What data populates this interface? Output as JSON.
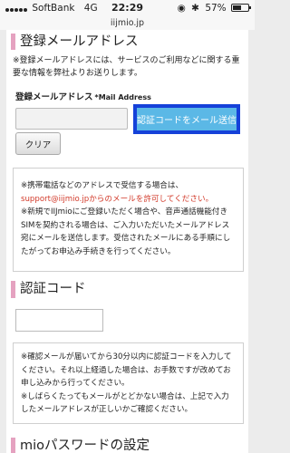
{
  "status": {
    "carrier": "SoftBank",
    "network": "4G",
    "time": "22:29",
    "battery": "57%",
    "battery_level": 0.57
  },
  "url": "iijmio.jp",
  "email_section": {
    "title": "登録メールアドレス",
    "description": "※登録メールアドレスには、サービスのご利用などに関する重要な情報を弊社よりお送りします。",
    "label": "登録メールアドレス",
    "label_sub": "*Mail Address",
    "email_value": "",
    "send_button": "認証コードをメール送信",
    "clear_button": "クリア",
    "notice": {
      "line1": "※携帯電話などのアドレスで受信する場合は、",
      "line2_red": "support@iijmio.jpからのメールを許可してください。",
      "line3": "※新規でIIJmioにご登録いただく場合や、音声通話機能付きSIMを契約される場合は、ご入力いただいたメールアドレス宛にメールを送信します。受信されたメールにある手順にしたがってお申込み手続きを行ってください。"
    }
  },
  "code_section": {
    "title": "認証コード",
    "code_value": "",
    "notice": {
      "line1": "※確認メールが届いてから30分以内に認証コードを入力してください。それ以上経過した場合は、お手数ですが改めてお申し込みから行ってください。",
      "line2": "※しばらくたってもメールがとどかない場合は、上記で入力したメールアドレスが正しいかご確認ください。"
    }
  },
  "password_section": {
    "title": "mioパスワードの設定"
  }
}
